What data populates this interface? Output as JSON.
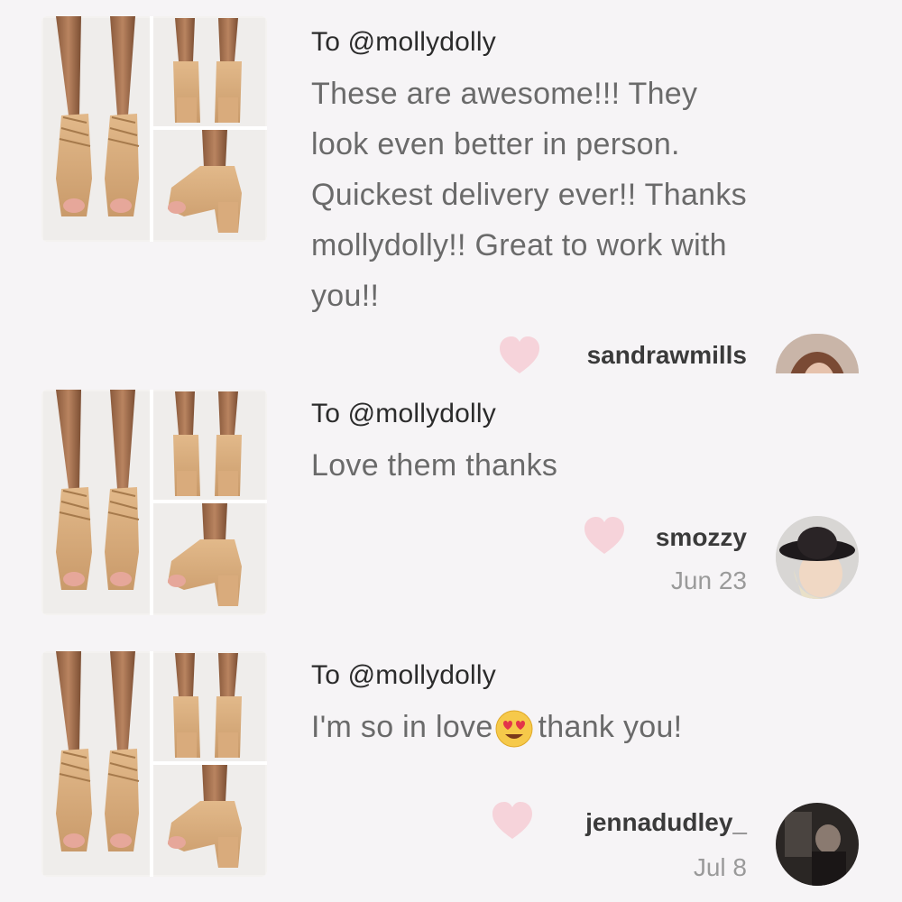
{
  "reviews": [
    {
      "recipient": "To @mollydolly",
      "message_lines": [
        "These are awesome!!! They",
        "look even better in person.",
        "Quickest delivery ever!! Thanks",
        "mollydolly!! Great to work with",
        "you!!"
      ],
      "username": "sandrawmills",
      "date": "",
      "avatar": "avatar-woman-brown-hair",
      "image": "tan-lace-up-heels-photo"
    },
    {
      "recipient": "To @mollydolly",
      "message_lines": [
        "Love them thanks"
      ],
      "username": "smozzy",
      "date": "Jun 23",
      "avatar": "avatar-woman-black-hat",
      "image": "tan-lace-up-heels-photo"
    },
    {
      "recipient": "To @mollydolly",
      "message_before_emoji": "I'm so in love",
      "emoji": "heart-eyes-emoji",
      "message_after_emoji": "thank you!",
      "username": "jennadudley_",
      "date": "Jul 8",
      "avatar": "avatar-dark-photo",
      "image": "tan-lace-up-heels-photo"
    }
  ],
  "colors": {
    "background": "#f6f4f6",
    "heart": "#f6d3da",
    "username": "#3a3a3a",
    "message": "#6a6a6a",
    "date": "#9a9a9a"
  }
}
